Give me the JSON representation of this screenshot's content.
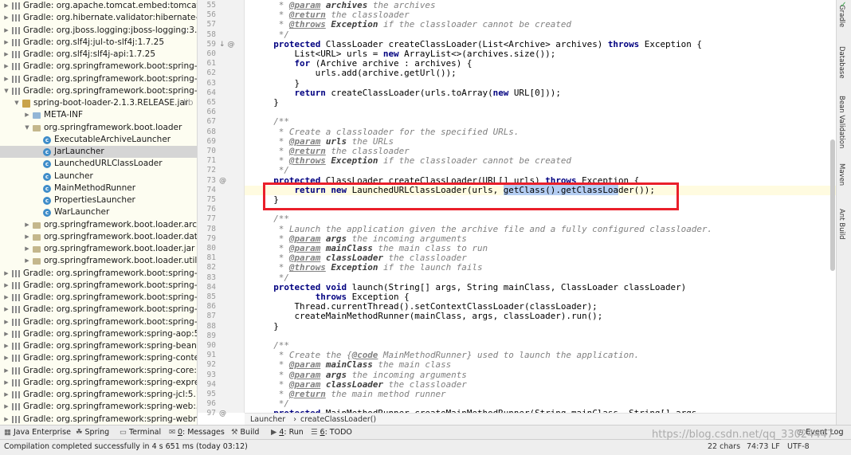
{
  "project_tree": [
    {
      "indent": 0,
      "arrow": "▶",
      "icon": "lib",
      "label": "Gradle: org.apache.tomcat.embed:tomcat-er"
    },
    {
      "indent": 0,
      "arrow": "▶",
      "icon": "lib",
      "label": "Gradle: org.hibernate.validator:hibernate-val"
    },
    {
      "indent": 0,
      "arrow": "▶",
      "icon": "lib",
      "label": "Gradle: org.jboss.logging:jboss-logging:3.3."
    },
    {
      "indent": 0,
      "arrow": "▶",
      "icon": "lib",
      "label": "Gradle: org.slf4j:jul-to-slf4j:1.7.25"
    },
    {
      "indent": 0,
      "arrow": "▶",
      "icon": "lib",
      "label": "Gradle: org.slf4j:slf4j-api:1.7.25"
    },
    {
      "indent": 0,
      "arrow": "▶",
      "icon": "lib",
      "label": "Gradle: org.springframework.boot:spring-bo"
    },
    {
      "indent": 0,
      "arrow": "▶",
      "icon": "lib",
      "label": "Gradle: org.springframework.boot:spring-bo"
    },
    {
      "indent": 0,
      "arrow": "▼",
      "icon": "lib",
      "label": "Gradle: org.springframework.boot:spring-bo"
    },
    {
      "indent": 1,
      "arrow": "▼",
      "icon": "jar",
      "label": "spring-boot-loader-2.1.3.RELEASE.jar",
      "suffix": " lib"
    },
    {
      "indent": 2,
      "arrow": "▶",
      "icon": "folder",
      "label": "META-INF"
    },
    {
      "indent": 2,
      "arrow": "▼",
      "icon": "pkg",
      "label": "org.springframework.boot.loader"
    },
    {
      "indent": 3,
      "arrow": "",
      "icon": "class",
      "label": "ExecutableArchiveLauncher"
    },
    {
      "indent": 3,
      "arrow": "",
      "icon": "class",
      "label": "JarLauncher",
      "selected": true
    },
    {
      "indent": 3,
      "arrow": "",
      "icon": "class",
      "label": "LaunchedURLClassLoader"
    },
    {
      "indent": 3,
      "arrow": "",
      "icon": "class",
      "label": "Launcher"
    },
    {
      "indent": 3,
      "arrow": "",
      "icon": "class",
      "label": "MainMethodRunner"
    },
    {
      "indent": 3,
      "arrow": "",
      "icon": "class",
      "label": "PropertiesLauncher"
    },
    {
      "indent": 3,
      "arrow": "",
      "icon": "class",
      "label": "WarLauncher"
    },
    {
      "indent": 2,
      "arrow": "▶",
      "icon": "pkg",
      "label": "org.springframework.boot.loader.archi"
    },
    {
      "indent": 2,
      "arrow": "▶",
      "icon": "pkg",
      "label": "org.springframework.boot.loader.data"
    },
    {
      "indent": 2,
      "arrow": "▶",
      "icon": "pkg",
      "label": "org.springframework.boot.loader.jar"
    },
    {
      "indent": 2,
      "arrow": "▶",
      "icon": "pkg",
      "label": "org.springframework.boot.loader.util"
    },
    {
      "indent": 0,
      "arrow": "▶",
      "icon": "lib",
      "label": "Gradle: org.springframework.boot:spring-bo"
    },
    {
      "indent": 0,
      "arrow": "▶",
      "icon": "lib",
      "label": "Gradle: org.springframework.boot:spring-bo"
    },
    {
      "indent": 0,
      "arrow": "▶",
      "icon": "lib",
      "label": "Gradle: org.springframework.boot:spring-bo"
    },
    {
      "indent": 0,
      "arrow": "▶",
      "icon": "lib",
      "label": "Gradle: org.springframework.boot:spring-bo"
    },
    {
      "indent": 0,
      "arrow": "▶",
      "icon": "lib",
      "label": "Gradle: org.springframework.boot:spring-bo"
    },
    {
      "indent": 0,
      "arrow": "▶",
      "icon": "lib",
      "label": "Gradle: org.springframework:spring-aop:5.1."
    },
    {
      "indent": 0,
      "arrow": "▶",
      "icon": "lib",
      "label": "Gradle: org.springframework:spring-beans:5"
    },
    {
      "indent": 0,
      "arrow": "▶",
      "icon": "lib",
      "label": "Gradle: org.springframework:spring-context"
    },
    {
      "indent": 0,
      "arrow": "▶",
      "icon": "lib",
      "label": "Gradle: org.springframework:spring-core:5.1"
    },
    {
      "indent": 0,
      "arrow": "▶",
      "icon": "lib",
      "label": "Gradle: org.springframework:spring-express"
    },
    {
      "indent": 0,
      "arrow": "▶",
      "icon": "lib",
      "label": "Gradle: org.springframework:spring-jcl:5.1.5"
    },
    {
      "indent": 0,
      "arrow": "▶",
      "icon": "lib",
      "label": "Gradle: org.springframework:spring-web:5.1"
    },
    {
      "indent": 0,
      "arrow": "▶",
      "icon": "lib",
      "label": "Gradle: org.springframework:spring-webmvc"
    }
  ],
  "editor": {
    "current_line": 74,
    "gutter_marks": {
      "59": "↓ @",
      "73": "@",
      "97": "@"
    },
    "lines": [
      {
        "n": "55",
        "s": [
          [
            "cm",
            "     * "
          ],
          [
            "tg",
            "@param"
          ],
          [
            "cm",
            " "
          ],
          [
            "tv",
            "archives"
          ],
          [
            "cm",
            " the archives"
          ]
        ]
      },
      {
        "n": "56",
        "s": [
          [
            "cm",
            "     * "
          ],
          [
            "tg",
            "@return"
          ],
          [
            "cm",
            " the classloader"
          ]
        ]
      },
      {
        "n": "57",
        "s": [
          [
            "cm",
            "     * "
          ],
          [
            "tg",
            "@throws"
          ],
          [
            "cm",
            " "
          ],
          [
            "tv",
            "Exception"
          ],
          [
            "cm",
            " if the classloader cannot be created"
          ]
        ]
      },
      {
        "n": "58",
        "s": [
          [
            "cm",
            "     */"
          ]
        ]
      },
      {
        "n": "59",
        "s": [
          [
            "",
            "    "
          ],
          [
            "kw",
            "protected"
          ],
          [
            "",
            " ClassLoader createClassLoader(List<Archive> archives) "
          ],
          [
            "kw",
            "throws"
          ],
          [
            "",
            " Exception {"
          ]
        ]
      },
      {
        "n": "60",
        "s": [
          [
            "",
            "        List<URL> urls = "
          ],
          [
            "kw",
            "new"
          ],
          [
            "",
            " ArrayList<>(archives.size());"
          ]
        ]
      },
      {
        "n": "61",
        "s": [
          [
            "",
            "        "
          ],
          [
            "kw",
            "for"
          ],
          [
            "",
            " (Archive archive : archives) {"
          ]
        ]
      },
      {
        "n": "62",
        "s": [
          [
            "",
            "            urls.add(archive.getUrl());"
          ]
        ]
      },
      {
        "n": "63",
        "s": [
          [
            "",
            "        }"
          ]
        ]
      },
      {
        "n": "64",
        "s": [
          [
            "",
            "        "
          ],
          [
            "kw",
            "return"
          ],
          [
            "",
            " createClassLoader(urls.toArray("
          ],
          [
            "kw",
            "new"
          ],
          [
            "",
            " URL[0]));"
          ]
        ]
      },
      {
        "n": "65",
        "s": [
          [
            "",
            "    }"
          ]
        ]
      },
      {
        "n": "66",
        "s": [
          [
            "",
            ""
          ]
        ]
      },
      {
        "n": "67",
        "s": [
          [
            "cm",
            "    /**"
          ]
        ]
      },
      {
        "n": "68",
        "s": [
          [
            "cm",
            "     * Create a classloader for the specified URLs."
          ]
        ]
      },
      {
        "n": "69",
        "s": [
          [
            "cm",
            "     * "
          ],
          [
            "tg",
            "@param"
          ],
          [
            "cm",
            " "
          ],
          [
            "tv",
            "urls"
          ],
          [
            "cm",
            " the URLs"
          ]
        ]
      },
      {
        "n": "70",
        "s": [
          [
            "cm",
            "     * "
          ],
          [
            "tg",
            "@return"
          ],
          [
            "cm",
            " the classloader"
          ]
        ]
      },
      {
        "n": "71",
        "s": [
          [
            "cm",
            "     * "
          ],
          [
            "tg",
            "@throws"
          ],
          [
            "cm",
            " "
          ],
          [
            "tv",
            "Exception"
          ],
          [
            "cm",
            " if the classloader cannot be created"
          ]
        ]
      },
      {
        "n": "72",
        "s": [
          [
            "cm",
            "     */"
          ]
        ]
      },
      {
        "n": "73",
        "s": [
          [
            "",
            "    "
          ],
          [
            "kw",
            "protected"
          ],
          [
            "",
            " ClassLoader createClassLoader(URL[] urls) "
          ],
          [
            "kw",
            "throws"
          ],
          [
            "",
            " Exception {"
          ]
        ]
      },
      {
        "n": "74",
        "s": [
          [
            "",
            "        "
          ],
          [
            "kw",
            "return"
          ],
          [
            "",
            " "
          ],
          [
            "kw",
            "new"
          ],
          [
            "",
            " LaunchedURLClassLoader(urls, "
          ],
          [
            "hl",
            "getClass().getClassLoa"
          ],
          [
            "",
            "der());"
          ]
        ]
      },
      {
        "n": "75",
        "s": [
          [
            "",
            "    }"
          ]
        ]
      },
      {
        "n": "76",
        "s": [
          [
            "",
            ""
          ]
        ]
      },
      {
        "n": "77",
        "s": [
          [
            "cm",
            "    /**"
          ]
        ]
      },
      {
        "n": "78",
        "s": [
          [
            "cm",
            "     * Launch the application given the archive file and a fully configured classloader."
          ]
        ]
      },
      {
        "n": "79",
        "s": [
          [
            "cm",
            "     * "
          ],
          [
            "tg",
            "@param"
          ],
          [
            "cm",
            " "
          ],
          [
            "tv",
            "args"
          ],
          [
            "cm",
            " the incoming arguments"
          ]
        ]
      },
      {
        "n": "80",
        "s": [
          [
            "cm",
            "     * "
          ],
          [
            "tg",
            "@param"
          ],
          [
            "cm",
            " "
          ],
          [
            "tv",
            "mainClass"
          ],
          [
            "cm",
            " the main class to run"
          ]
        ]
      },
      {
        "n": "81",
        "s": [
          [
            "cm",
            "     * "
          ],
          [
            "tg",
            "@param"
          ],
          [
            "cm",
            " "
          ],
          [
            "tv",
            "classLoader"
          ],
          [
            "cm",
            " the classloader"
          ]
        ]
      },
      {
        "n": "82",
        "s": [
          [
            "cm",
            "     * "
          ],
          [
            "tg",
            "@throws"
          ],
          [
            "cm",
            " "
          ],
          [
            "tv",
            "Exception"
          ],
          [
            "cm",
            " if the launch fails"
          ]
        ]
      },
      {
        "n": "83",
        "s": [
          [
            "cm",
            "     */"
          ]
        ]
      },
      {
        "n": "84",
        "s": [
          [
            "",
            "    "
          ],
          [
            "kw",
            "protected void"
          ],
          [
            "",
            " launch(String[] args, String mainClass, ClassLoader classLoader)"
          ]
        ]
      },
      {
        "n": "85",
        "s": [
          [
            "",
            "            "
          ],
          [
            "kw",
            "throws"
          ],
          [
            "",
            " Exception {"
          ]
        ]
      },
      {
        "n": "86",
        "s": [
          [
            "",
            "        Thread.currentThread().setContextClassLoader(classLoader);"
          ]
        ]
      },
      {
        "n": "87",
        "s": [
          [
            "",
            "        createMainMethodRunner(mainClass, args, classLoader).run();"
          ]
        ]
      },
      {
        "n": "88",
        "s": [
          [
            "",
            "    }"
          ]
        ]
      },
      {
        "n": "89",
        "s": [
          [
            "",
            ""
          ]
        ]
      },
      {
        "n": "90",
        "s": [
          [
            "cm",
            "    /**"
          ]
        ]
      },
      {
        "n": "91",
        "s": [
          [
            "cm",
            "     * Create the {"
          ],
          [
            "tg",
            "@code"
          ],
          [
            "cm",
            " MainMethodRunner} used to launch the application."
          ]
        ]
      },
      {
        "n": "92",
        "s": [
          [
            "cm",
            "     * "
          ],
          [
            "tg",
            "@param"
          ],
          [
            "cm",
            " "
          ],
          [
            "tv",
            "mainClass"
          ],
          [
            "cm",
            " the main class"
          ]
        ]
      },
      {
        "n": "93",
        "s": [
          [
            "cm",
            "     * "
          ],
          [
            "tg",
            "@param"
          ],
          [
            "cm",
            " "
          ],
          [
            "tv",
            "args"
          ],
          [
            "cm",
            " the incoming arguments"
          ]
        ]
      },
      {
        "n": "94",
        "s": [
          [
            "cm",
            "     * "
          ],
          [
            "tg",
            "@param"
          ],
          [
            "cm",
            " "
          ],
          [
            "tv",
            "classLoader"
          ],
          [
            "cm",
            " the classloader"
          ]
        ]
      },
      {
        "n": "95",
        "s": [
          [
            "cm",
            "     * "
          ],
          [
            "tg",
            "@return"
          ],
          [
            "cm",
            " the main method runner"
          ]
        ]
      },
      {
        "n": "96",
        "s": [
          [
            "cm",
            "     */"
          ]
        ]
      },
      {
        "n": "97",
        "s": [
          [
            "",
            "    "
          ],
          [
            "kw",
            "protected"
          ],
          [
            "",
            " MainMethodRunner createMainMethodRunner(String mainClass, String[] args,"
          ]
        ]
      }
    ]
  },
  "breadcrumb": {
    "class_name": "Launcher",
    "method_name": "createClassLoader()"
  },
  "right_tabs": [
    "Gradle",
    "Database",
    "Bean Validation",
    "Maven",
    "Ant Build"
  ],
  "toolbar": {
    "java_enterprise": "Java Enterprise",
    "spring": "Spring",
    "terminal": "Terminal",
    "messages_num": "0",
    "messages_label": ": Messages",
    "build": "Build",
    "run_num": "4",
    "run_label": ": Run",
    "todo_num": "6",
    "todo_label": ": TODO",
    "event_log": "Event Log"
  },
  "status": {
    "message": "Compilation completed successfully in 4 s 651 ms (today 03:12)",
    "chars": "22 chars",
    "position": "74:73",
    "line_sep": "LF",
    "encoding": "UTF-8"
  },
  "watermark": "https://blog.csdn.net/qq_33024447"
}
